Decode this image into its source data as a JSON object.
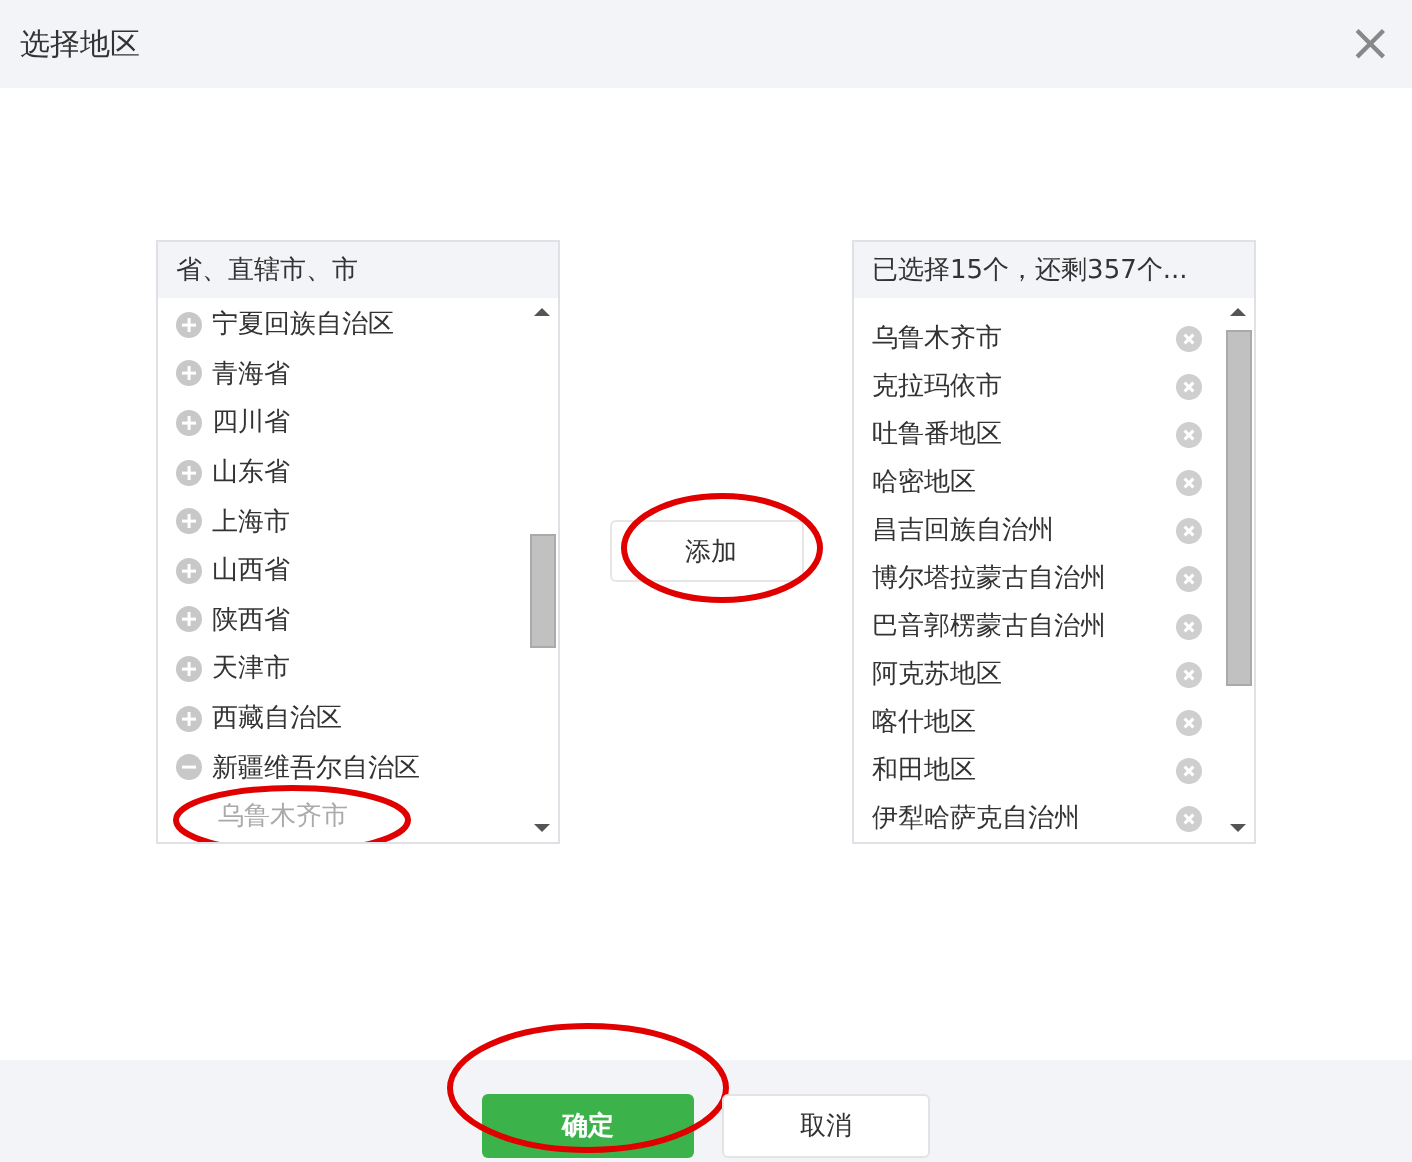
{
  "window": {
    "title": "选择地区",
    "close": "×"
  },
  "available": {
    "header": "省、直辖市、市",
    "items": [
      {
        "label": "宁夏回族自治区",
        "expanded": false
      },
      {
        "label": "青海省",
        "expanded": false
      },
      {
        "label": "四川省",
        "expanded": false
      },
      {
        "label": "山东省",
        "expanded": false
      },
      {
        "label": "上海市",
        "expanded": false
      },
      {
        "label": "山西省",
        "expanded": false
      },
      {
        "label": "陕西省",
        "expanded": false
      },
      {
        "label": "天津市",
        "expanded": false
      },
      {
        "label": "西藏自治区",
        "expanded": false
      },
      {
        "label": "新疆维吾尔自治区",
        "expanded": true,
        "children": [
          {
            "label": "乌鲁木齐市",
            "disabled": true,
            "circled": true
          }
        ]
      }
    ]
  },
  "add_button": {
    "label": "添加",
    "circled": true
  },
  "selected": {
    "header": "已选择15个，还剩357个...",
    "items": [
      "乌鲁木齐市",
      "克拉玛依市",
      "吐鲁番地区",
      "哈密地区",
      "昌吉回族自治州",
      "博尔塔拉蒙古自治州",
      "巴音郭楞蒙古自治州",
      "阿克苏地区",
      "喀什地区",
      "和田地区",
      "伊犁哈萨克自治州"
    ]
  },
  "buttons": [
    {
      "label": "确定",
      "kind": "primary",
      "circled": true
    },
    {
      "label": "取消",
      "kind": "secondary",
      "circled": false
    }
  ]
}
